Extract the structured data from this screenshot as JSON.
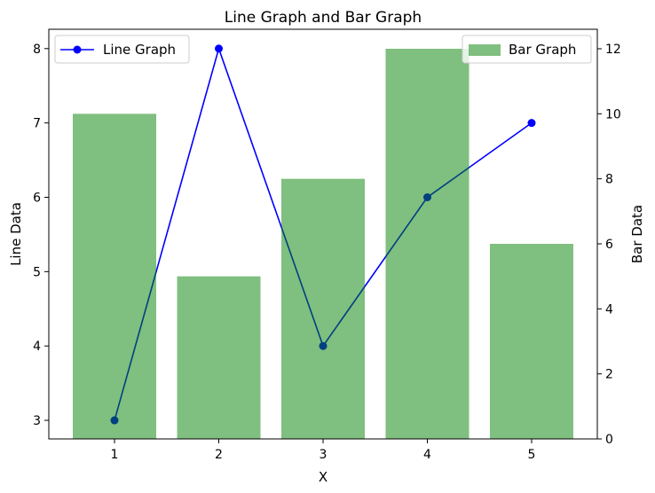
{
  "chart_data": {
    "type": "bar+line",
    "title": "Line Graph and Bar Graph",
    "xlabel": "X",
    "ylabel_left": "Line Data",
    "ylabel_right": "Bar Data",
    "x": [
      1,
      2,
      3,
      4,
      5
    ],
    "xlim": [
      0.37,
      5.63
    ],
    "ylim_left": [
      2.75,
      8.26
    ],
    "ylim_right": [
      0,
      12.6
    ],
    "xticks": [
      1,
      2,
      3,
      4,
      5
    ],
    "yticks_left": [
      3,
      4,
      5,
      6,
      7,
      8
    ],
    "yticks_right": [
      0,
      2,
      4,
      6,
      8,
      10,
      12
    ],
    "grid": false,
    "series": [
      {
        "name": "Line Graph",
        "type": "line",
        "axis": "left",
        "values": [
          3,
          8,
          4,
          6,
          7
        ],
        "color": "#0000ff",
        "marker": "circle"
      },
      {
        "name": "Bar Graph",
        "type": "bar",
        "axis": "right",
        "values": [
          10,
          5,
          8,
          12,
          6
        ],
        "color": "#008000",
        "alpha": 0.5,
        "bar_width": 0.8
      }
    ],
    "legends": [
      {
        "series": "Line Graph",
        "placement": "upper-left"
      },
      {
        "series": "Bar Graph",
        "placement": "upper-right"
      }
    ],
    "right_label_color": "#008000"
  }
}
